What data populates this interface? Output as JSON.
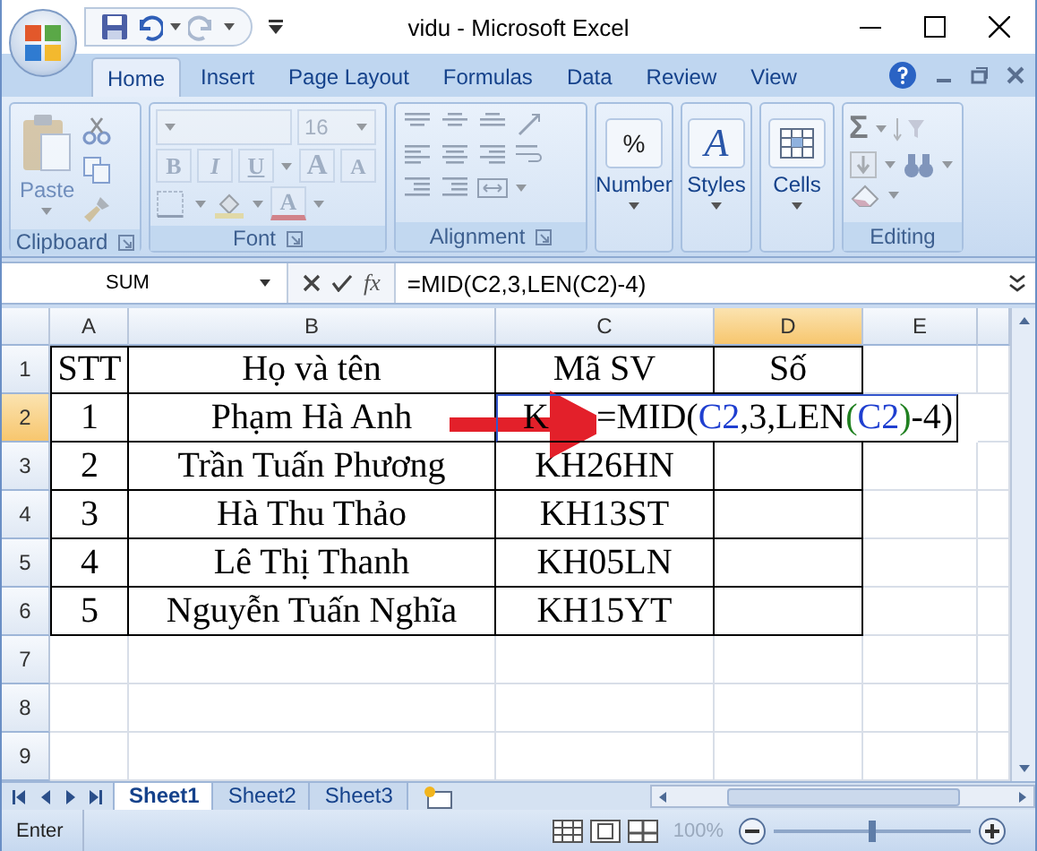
{
  "window": {
    "title": "vidu - Microsoft Excel"
  },
  "tabs": [
    {
      "label": "Home",
      "selected": true
    },
    {
      "label": "Insert",
      "selected": false
    },
    {
      "label": "Page Layout",
      "selected": false
    },
    {
      "label": "Formulas",
      "selected": false
    },
    {
      "label": "Data",
      "selected": false
    },
    {
      "label": "Review",
      "selected": false
    },
    {
      "label": "View",
      "selected": false
    }
  ],
  "ribbon": {
    "disabled": true,
    "groups": [
      {
        "kind": "clipboard",
        "label": "Clipboard",
        "button": "Paste"
      },
      {
        "kind": "font",
        "label": "Font",
        "font_size": "16",
        "format_buttons": [
          "B",
          "I",
          "U"
        ],
        "size_buttons": [
          "A",
          "A"
        ],
        "color_button": "A"
      },
      {
        "kind": "alignment",
        "label": "Alignment"
      },
      {
        "kind": "number",
        "button": "Number",
        "symbol": "%"
      },
      {
        "kind": "styles",
        "button": "Styles",
        "symbol": "A"
      },
      {
        "kind": "cells",
        "button": "Cells"
      },
      {
        "kind": "editing",
        "label": "Editing",
        "symbol": "Σ"
      }
    ]
  },
  "formula_bar": {
    "name_box": "SUM",
    "function_button": "fx",
    "formula": "=MID(C2,3,LEN(C2)-4)"
  },
  "sheet": {
    "columns": [
      {
        "label": "A",
        "selected": false
      },
      {
        "label": "B",
        "selected": false
      },
      {
        "label": "C",
        "selected": false
      },
      {
        "label": "D",
        "selected": true
      },
      {
        "label": "E",
        "selected": false
      }
    ],
    "rows": [
      {
        "label": "1",
        "selected": false,
        "cells": [
          "STT",
          "Họ và tên",
          "Mã SV",
          "Số"
        ]
      },
      {
        "label": "2",
        "selected": true,
        "cells": [
          "1",
          "Phạm Hà Anh",
          {
            "text": "K",
            "referenced": true
          }
        ],
        "edit": [
          {
            "text": "=MID(",
            "color": "#000000"
          },
          {
            "text": "C2",
            "color": "#1f3fd0"
          },
          {
            "text": ",3,LEN",
            "color": "#000000"
          },
          {
            "text": "(",
            "color": "#208020"
          },
          {
            "text": "C2",
            "color": "#1f3fd0"
          },
          {
            "text": ")",
            "color": "#208020"
          },
          {
            "text": "-4)",
            "color": "#000000"
          }
        ]
      },
      {
        "label": "3",
        "selected": false,
        "cells": [
          "2",
          "Trần Tuấn Phương",
          "KH26HN"
        ]
      },
      {
        "label": "4",
        "selected": false,
        "cells": [
          "3",
          "Hà Thu Thảo",
          "KH13ST"
        ]
      },
      {
        "label": "5",
        "selected": false,
        "cells": [
          "4",
          "Lê Thị Thanh",
          "KH05LN"
        ]
      },
      {
        "label": "6",
        "selected": false,
        "cells": [
          "5",
          "Nguyễn Tuấn Nghĩa",
          "KH15YT"
        ]
      },
      {
        "label": "7",
        "selected": false
      },
      {
        "label": "8",
        "selected": false
      },
      {
        "label": "9",
        "selected": false
      }
    ]
  },
  "sheet_tabs": [
    {
      "label": "Sheet1",
      "selected": true
    },
    {
      "label": "Sheet2",
      "selected": false
    },
    {
      "label": "Sheet3",
      "selected": false
    }
  ],
  "status_bar": {
    "mode": "Enter",
    "zoom": "100%",
    "zoom_slider": {
      "level": 0.5
    }
  }
}
